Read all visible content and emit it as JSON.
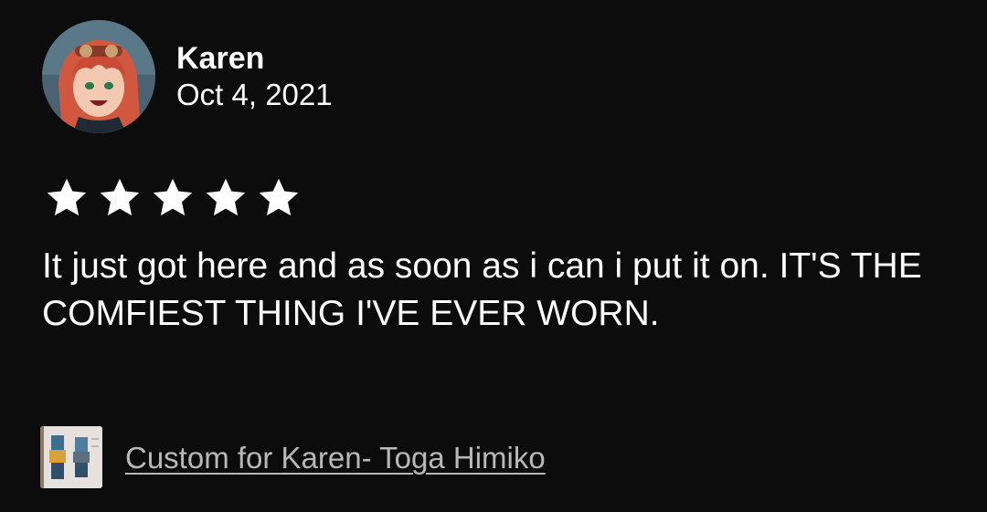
{
  "review": {
    "reviewer_name": "Karen",
    "date": "Oct 4, 2021",
    "rating": 5,
    "rating_max": 5,
    "text": "It just got here and as soon as i can i put it on. IT'S THE COMFIEST THING I'VE EVER WORN.",
    "item_title": "Custom for Karen- Toga Himiko"
  },
  "icons": {
    "avatar": "avatar-image",
    "star": "star-icon",
    "item_thumbnail": "item-thumbnail-image"
  },
  "colors": {
    "background": "#0c0c0d",
    "text": "#ffffff",
    "link": "#b8b8b8",
    "star": "#ffffff"
  }
}
